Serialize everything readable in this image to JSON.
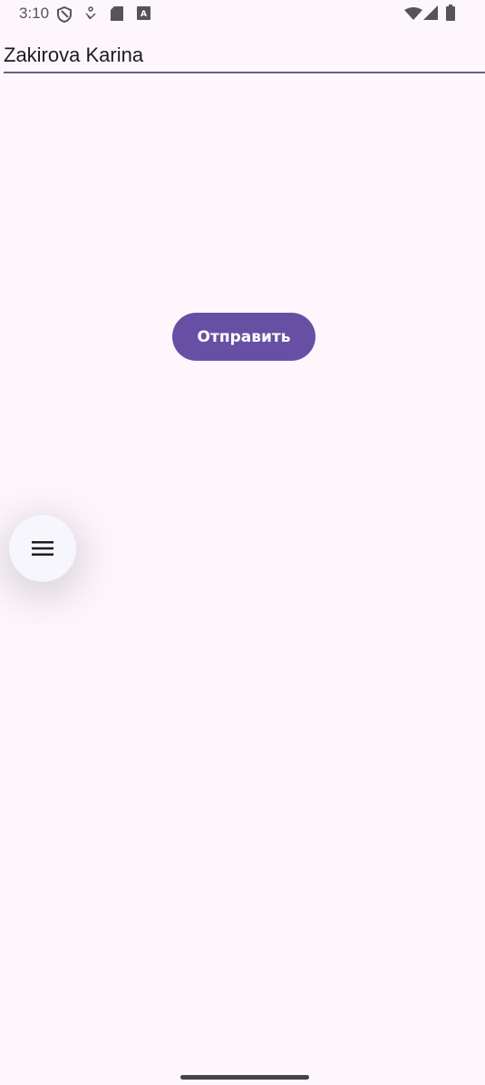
{
  "status_bar": {
    "time": "3:10",
    "left_icons": [
      "shield-icon",
      "download-icon",
      "sd-card-icon",
      "keyboard-a-icon"
    ],
    "right_icons": [
      "wifi-icon",
      "signal-icon",
      "battery-icon"
    ]
  },
  "name_field": {
    "value": "Zakirova Karina"
  },
  "send_button": {
    "label": "Отправить",
    "color": "#6750a4"
  },
  "menu_fab": {
    "icon": "menu-icon"
  }
}
